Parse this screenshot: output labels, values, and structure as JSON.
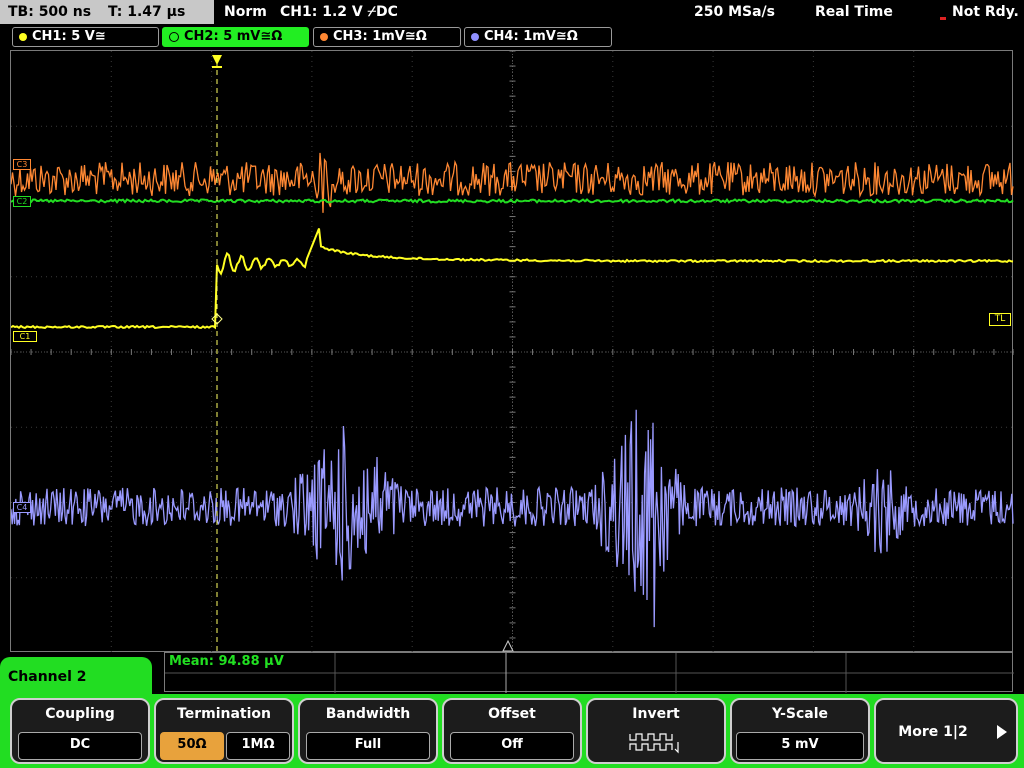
{
  "top": {
    "tb": "TB: 500 ns",
    "trigger_time": "T: 1.47 µs",
    "mode": "Norm",
    "trigger": "CH1: 1.2 V ⌿DC",
    "sample_rate": "250 MSa/s",
    "acq_mode": "Real Time",
    "status": "Not Rdy."
  },
  "channels": [
    {
      "label": "CH1: 5 V≅",
      "color": "#ffff22"
    },
    {
      "label": "CH2: 5 mV≅Ω",
      "color": "#22dd22"
    },
    {
      "label": "CH3: 1mV≅Ω",
      "color": "#ff8833"
    },
    {
      "label": "CH4: 1mV≅Ω",
      "color": "#9090ff"
    }
  ],
  "markers": {
    "c3": "C3",
    "c2": "C2",
    "c1": "C1",
    "c4": "C4",
    "tl": "TL"
  },
  "measurement": {
    "text": "Mean: 94.88 µV"
  },
  "menu": {
    "channel_tab": "Channel 2",
    "coupling": {
      "title": "Coupling",
      "value": "DC"
    },
    "termination": {
      "title": "Termination",
      "opt1": "50Ω",
      "opt2": "1MΩ"
    },
    "bandwidth": {
      "title": "Bandwidth",
      "value": "Full"
    },
    "offset": {
      "title": "Offset",
      "value": "Off"
    },
    "invert": {
      "title": "Invert"
    },
    "yscale": {
      "title": "Y-Scale",
      "value": "5 mV"
    },
    "more": {
      "label": "More 1|2"
    }
  }
}
